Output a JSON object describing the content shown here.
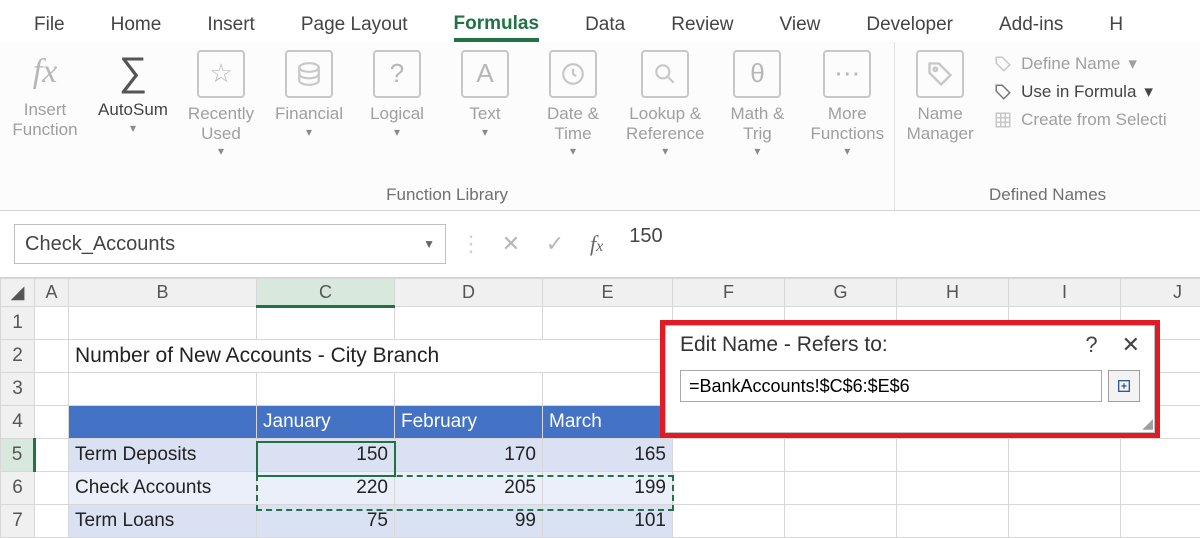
{
  "menubar": {
    "tabs": [
      "File",
      "Home",
      "Insert",
      "Page Layout",
      "Formulas",
      "Data",
      "Review",
      "View",
      "Developer",
      "Add-ins",
      "H"
    ],
    "active_index": 4
  },
  "ribbon": {
    "function_library": {
      "label": "Function Library",
      "insert_function": "Insert\nFunction",
      "autosum": "AutoSum",
      "recently_used": "Recently\nUsed",
      "financial": "Financial",
      "logical": "Logical",
      "text": "Text",
      "date_time": "Date &\nTime",
      "lookup_ref": "Lookup &\nReference",
      "math_trig": "Math &\nTrig",
      "more_functions": "More\nFunctions"
    },
    "defined_names": {
      "label": "Defined Names",
      "name_manager": "Name\nManager",
      "define_name": "Define Name",
      "use_in_formula": "Use in Formula",
      "create_from_selection": "Create from Selecti"
    }
  },
  "formula_bar": {
    "name_box": "Check_Accounts",
    "formula_value": "150"
  },
  "sheet": {
    "columns": [
      "A",
      "B",
      "C",
      "D",
      "E",
      "F",
      "G",
      "H",
      "I",
      "J"
    ],
    "rows_shown": [
      "1",
      "2",
      "3",
      "4",
      "5",
      "6",
      "7"
    ],
    "active_col_index": 2,
    "active_row_index": 4,
    "title": "Number of New Accounts - City Branch",
    "header_row": [
      "",
      "January",
      "February",
      "March"
    ],
    "data_rows": [
      {
        "label": "Term Deposits",
        "values": [
          "150",
          "170",
          "165"
        ]
      },
      {
        "label": "Check Accounts",
        "values": [
          "220",
          "205",
          "199"
        ]
      },
      {
        "label": "Term Loans",
        "values": [
          "75",
          "99",
          "101"
        ]
      }
    ]
  },
  "edit_name_dialog": {
    "title": "Edit Name - Refers to:",
    "value": "=BankAccounts!$C$6:$E$6"
  }
}
